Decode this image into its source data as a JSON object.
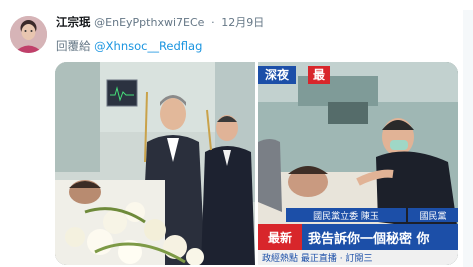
{
  "tweet": {
    "name": "江宗珉",
    "handle": "@EnEyPpthxwi7ECe",
    "separator": "·",
    "date": "12月9日",
    "reply_prefix": "回覆給",
    "reply_mention": "@Xhnsoc__Redflag"
  },
  "media": {
    "left_icon": "hospital-bedside-photo",
    "right_icon": "news-broadcast-photo",
    "news": {
      "tag_left": "深夜",
      "tag_right": "最",
      "banner_top_1": "國民黨立委 陳玉",
      "banner_top_2": "國民黨",
      "label_new": "最新",
      "headline": "我告訴你一個秘密 你",
      "ticker": "政經熱點 最正直播 · 訂閱三"
    }
  },
  "colors": {
    "name": "#14171a",
    "meta": "#657786",
    "link": "#1b95e0",
    "news_red": "#d8262b",
    "news_blue": "#1c4fa8"
  }
}
